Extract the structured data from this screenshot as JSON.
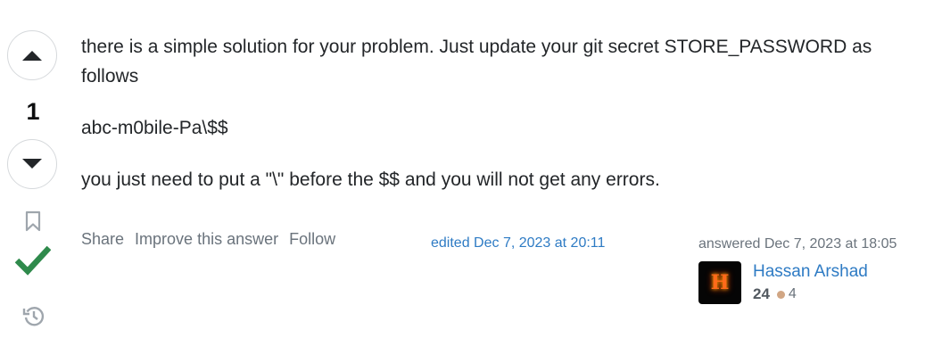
{
  "vote": {
    "count": "1"
  },
  "post": {
    "paragraphs": [
      "there is a simple solution for your problem. Just update your git secret STORE_PASSWORD as follows",
      "abc-m0bile-Pa\\$$",
      "you just need to put a \"\\\" before the $$ and you will not get any errors."
    ]
  },
  "menu": {
    "share": "Share",
    "improve": "Improve this answer",
    "follow": "Follow"
  },
  "edited": {
    "label": "edited Dec 7, 2023 at 20:11"
  },
  "user": {
    "answered": "answered Dec 7, 2023 at 18:05",
    "avatar_letter": "H",
    "name": "Hassan Arshad",
    "reputation": "24",
    "bronze_badges": "4"
  },
  "colors": {
    "accepted": "#2f8a4c",
    "link": "#2e7bc4",
    "muted": "#6a737c",
    "bronze": "#d1a684"
  },
  "icons": [
    "arrow-up-icon",
    "arrow-down-icon",
    "bookmark-icon",
    "checkmark-icon",
    "history-icon"
  ]
}
